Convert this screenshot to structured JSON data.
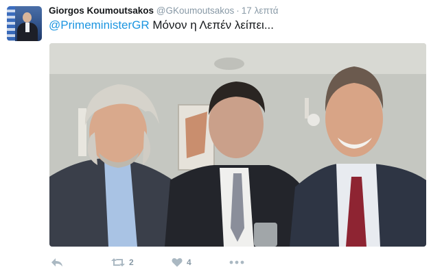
{
  "tweet": {
    "author_name": "Giorgos Koumoutsakos",
    "handle": "@GKoumoutsakos",
    "separator": "·",
    "timestamp": "17 λεπτά",
    "mention": "@PrimeministerGR",
    "text": " Μόνον η Λεπέν λείπει..."
  },
  "actions": {
    "retweet_count": "2",
    "like_count": "4"
  },
  "icons": [
    "reply-icon",
    "retweet-icon",
    "heart-icon",
    "more-icon"
  ],
  "colors": {
    "mention": "#1b95e0",
    "meta": "#8899a6",
    "icon": "#aab8c2"
  }
}
